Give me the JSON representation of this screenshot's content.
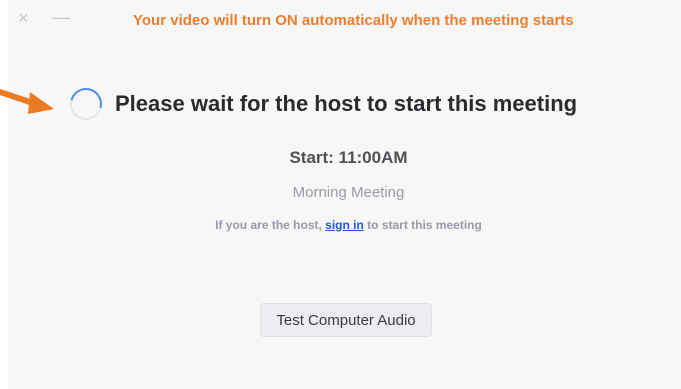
{
  "titlebar": {
    "close_glyph": "×",
    "minimize_glyph": "—"
  },
  "banner": {
    "text": "Your video will turn ON automatically when the meeting starts",
    "color": "#ef7d2c"
  },
  "main": {
    "headline": "Please wait for the host to start this meeting",
    "start_time": "Start: 11:00AM",
    "meeting_name": "Morning Meeting",
    "host_prefix": "If you are the host, ",
    "sign_in_link": "sign in",
    "host_suffix": " to start this meeting"
  },
  "actions": {
    "test_audio_label": "Test Computer Audio"
  },
  "icons": {
    "spinner": "loading-spinner-icon",
    "arrow": "orange-arrow-icon"
  },
  "colors": {
    "accent_orange": "#ef7d2c",
    "link_blue": "#1f5ccc",
    "spinner_blue": "#4a8fe2"
  }
}
